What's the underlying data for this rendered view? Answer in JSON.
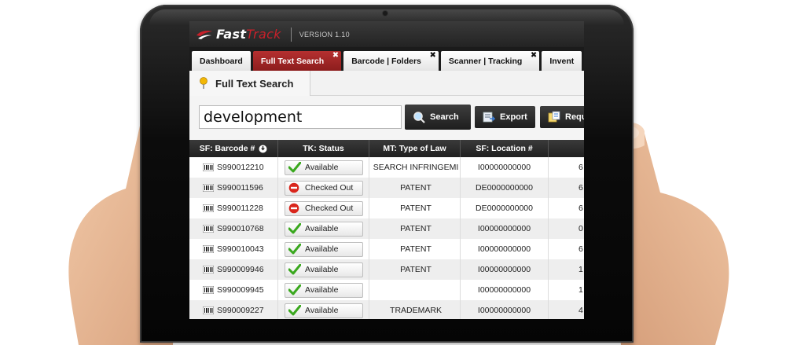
{
  "app": {
    "logo_main": "Fast",
    "logo_accent": "Track",
    "version": "VERSION 1.10"
  },
  "tabs": [
    {
      "label": "Dashboard",
      "active": false,
      "closable": false
    },
    {
      "label": "Full Text Search",
      "active": true,
      "closable": true
    },
    {
      "label": "Barcode | Folders",
      "active": false,
      "closable": true
    },
    {
      "label": "Scanner | Tracking",
      "active": false,
      "closable": true
    },
    {
      "label": "Invent",
      "active": false,
      "closable": false
    }
  ],
  "tab_close_glyph": "✖",
  "page": {
    "title": "Full Text Search"
  },
  "search": {
    "value": "development",
    "search_label": "Search",
    "export_label": "Export",
    "request_label": "Requ"
  },
  "table": {
    "headers": [
      "SF: Barcode #",
      "TK: Status",
      "MT: Type of Law",
      "SF: Location #",
      "C"
    ],
    "rows": [
      {
        "barcode": "S990012210",
        "status": "Available",
        "status_type": "ok",
        "type": "SEARCH INFRINGEMI",
        "location": "I00000000000",
        "extra": "6"
      },
      {
        "barcode": "S990011596",
        "status": "Checked Out",
        "status_type": "out",
        "type": "PATENT",
        "location": "DE0000000000",
        "extra": "6"
      },
      {
        "barcode": "S990011228",
        "status": "Checked Out",
        "status_type": "out",
        "type": "PATENT",
        "location": "DE0000000000",
        "extra": "6"
      },
      {
        "barcode": "S990010768",
        "status": "Available",
        "status_type": "ok",
        "type": "PATENT",
        "location": "I00000000000",
        "extra": "0"
      },
      {
        "barcode": "S990010043",
        "status": "Available",
        "status_type": "ok",
        "type": "PATENT",
        "location": "I00000000000",
        "extra": "6"
      },
      {
        "barcode": "S990009946",
        "status": "Available",
        "status_type": "ok",
        "type": "PATENT",
        "location": "I00000000000",
        "extra": "1"
      },
      {
        "barcode": "S990009945",
        "status": "Available",
        "status_type": "ok",
        "type": "",
        "location": "I00000000000",
        "extra": "1"
      },
      {
        "barcode": "S990009227",
        "status": "Available",
        "status_type": "ok",
        "type": "TRADEMARK",
        "location": "I00000000000",
        "extra": "4"
      }
    ]
  },
  "colors": {
    "active_tab": "#a52a2a",
    "brand_red": "#c8202a",
    "ok_green": "#3aa81e",
    "out_red": "#d9261c"
  }
}
